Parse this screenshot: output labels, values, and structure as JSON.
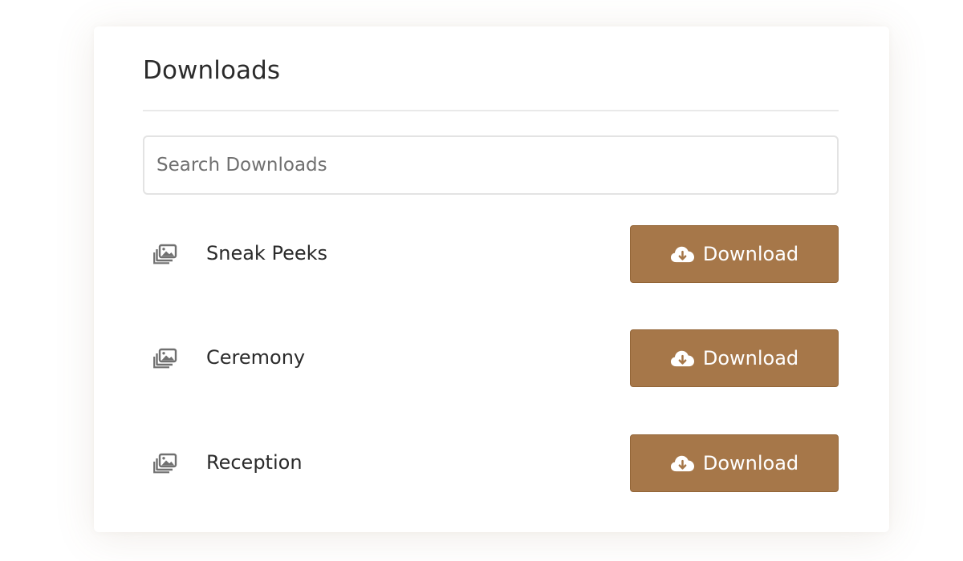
{
  "panel": {
    "title": "Downloads"
  },
  "search": {
    "placeholder": "Search Downloads",
    "value": ""
  },
  "items": [
    {
      "label": "Sneak Peeks",
      "icon": "photo-gallery-icon",
      "button_label": "Download",
      "button_icon": "cloud-download-icon"
    },
    {
      "label": "Ceremony",
      "icon": "photo-gallery-icon",
      "button_label": "Download",
      "button_icon": "cloud-download-icon"
    },
    {
      "label": "Reception",
      "icon": "photo-gallery-icon",
      "button_label": "Download",
      "button_icon": "cloud-download-icon"
    }
  ],
  "colors": {
    "accent": "#a67749",
    "text": "#2b2b2b",
    "muted_icon": "#707070",
    "border": "#e3e3e3"
  }
}
